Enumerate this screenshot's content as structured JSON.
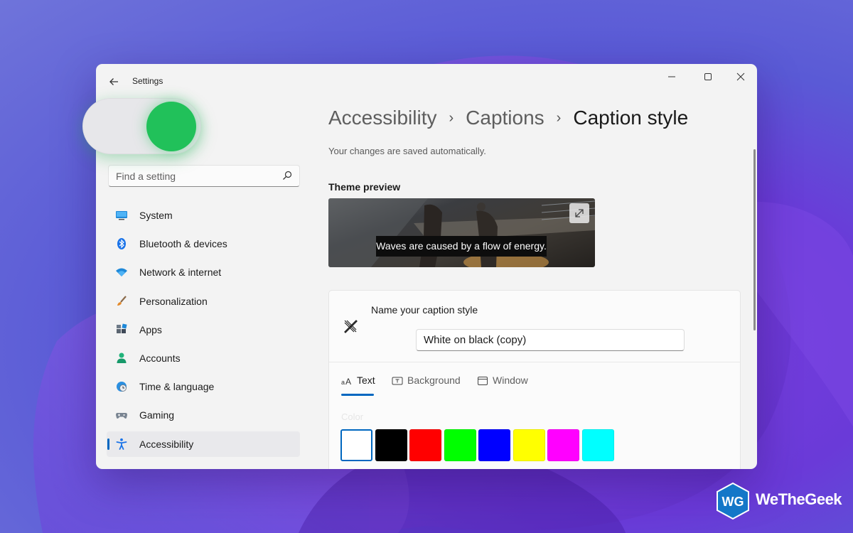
{
  "window": {
    "title": "Settings",
    "controls": {
      "minimize": "─",
      "maximize": "☐",
      "close": "✕"
    }
  },
  "toggle": {
    "state": "on",
    "color": "#21c15a"
  },
  "search": {
    "placeholder": "Find a setting",
    "icon": "search-icon"
  },
  "sidebar": {
    "items": [
      {
        "label": "System",
        "icon": "monitor-icon"
      },
      {
        "label": "Bluetooth & devices",
        "icon": "bluetooth-icon"
      },
      {
        "label": "Network & internet",
        "icon": "wifi-icon"
      },
      {
        "label": "Personalization",
        "icon": "brush-icon"
      },
      {
        "label": "Apps",
        "icon": "apps-icon"
      },
      {
        "label": "Accounts",
        "icon": "person-icon"
      },
      {
        "label": "Time & language",
        "icon": "globe-clock-icon"
      },
      {
        "label": "Gaming",
        "icon": "gamepad-icon"
      },
      {
        "label": "Accessibility",
        "icon": "accessibility-icon",
        "active": true
      }
    ]
  },
  "breadcrumb": {
    "level1": "Accessibility",
    "level2": "Captions",
    "current": "Caption style",
    "separator": "›"
  },
  "autosave_note": "Your changes are saved automatically.",
  "theme_preview": {
    "title": "Theme preview",
    "caption_text": "Waves are caused by a flow of energy."
  },
  "caption_style": {
    "name_label": "Name your caption style",
    "name_value": "White on black (copy)",
    "icon": "pen-ruler-icon"
  },
  "tabs": [
    {
      "label": "Text",
      "icon": "text-size-icon",
      "active": true
    },
    {
      "label": "Background",
      "icon": "text-box-icon"
    },
    {
      "label": "Window",
      "icon": "window-icon"
    }
  ],
  "color_section": {
    "label": "Color",
    "swatches": [
      "#ffffff",
      "#000000",
      "#ff0000",
      "#00ff00",
      "#0000ff",
      "#ffff00",
      "#ff00ff",
      "#00ffff"
    ],
    "selected_index": 0
  },
  "logo": {
    "text": "WeTheGeek",
    "mark": "WG"
  },
  "colors": {
    "accent": "#0067c0",
    "toggle_on": "#21c15a",
    "logo_blue": "#1477c8"
  }
}
